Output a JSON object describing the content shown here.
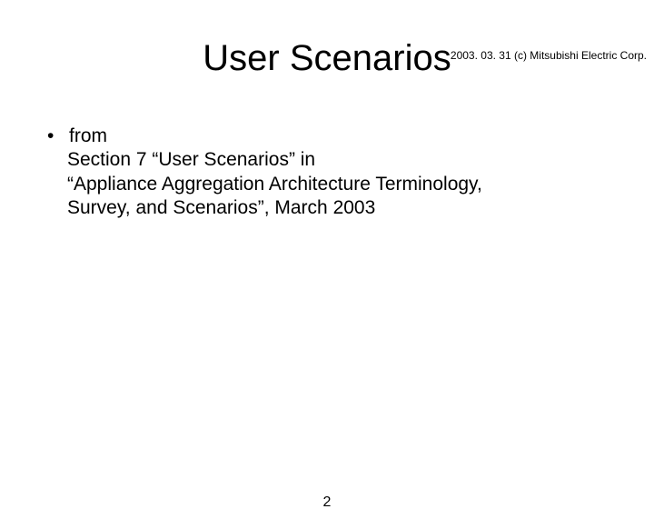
{
  "header": {
    "right_text": "2003. 03. 31 (c) Mitsubishi Electric Corp."
  },
  "title": "User Scenarios",
  "body": {
    "bullet_lead": "from",
    "line1": "Section 7 “User Scenarios” in",
    "line2": "“Appliance Aggregation Architecture Terminology,",
    "line3": "Survey, and Scenarios”, March 2003"
  },
  "page_number": "2"
}
